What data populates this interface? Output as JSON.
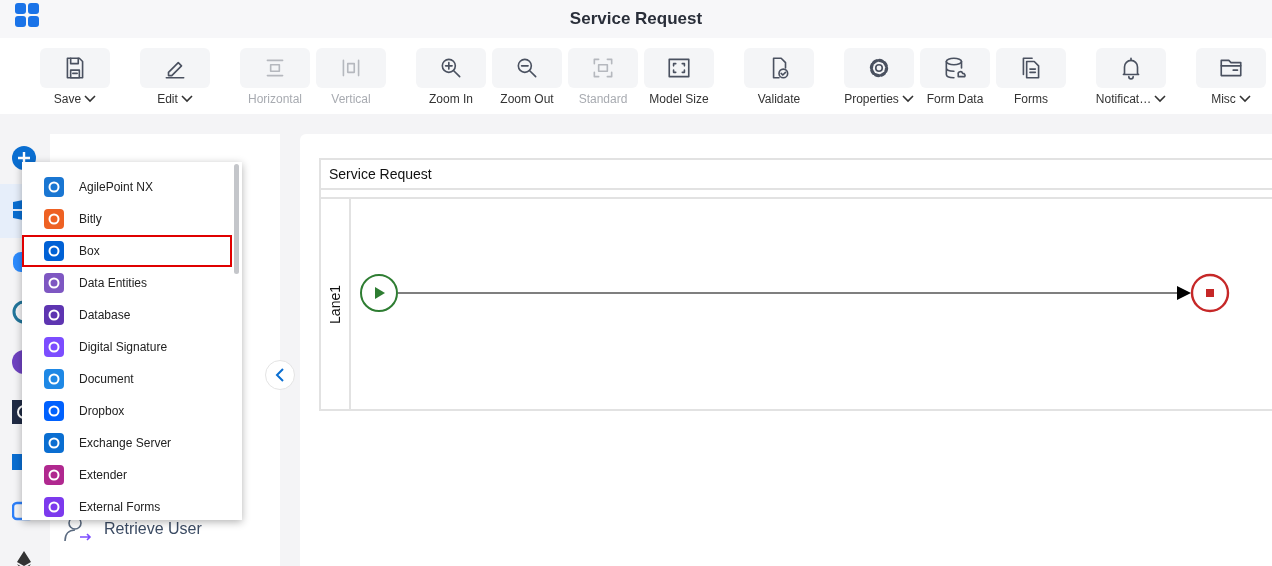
{
  "app": {
    "title": "Service Request"
  },
  "toolbar": [
    {
      "buttons": [
        {
          "label": "Save",
          "disabled": false,
          "menu": true
        }
      ]
    },
    {
      "buttons": [
        {
          "label": "Edit",
          "disabled": false,
          "menu": true
        }
      ]
    },
    {
      "buttons": [
        {
          "label": "Horizontal",
          "disabled": true,
          "menu": false
        },
        {
          "label": "Vertical",
          "disabled": true,
          "menu": false
        }
      ]
    },
    {
      "buttons": [
        {
          "label": "Zoom In",
          "disabled": false,
          "menu": false
        },
        {
          "label": "Zoom Out",
          "disabled": false,
          "menu": false
        },
        {
          "label": "Standard",
          "disabled": true,
          "menu": false
        },
        {
          "label": "Model Size",
          "disabled": false,
          "menu": false
        }
      ]
    },
    {
      "buttons": [
        {
          "label": "Validate",
          "disabled": false,
          "menu": false
        }
      ]
    },
    {
      "buttons": [
        {
          "label": "Properties",
          "disabled": false,
          "menu": true
        },
        {
          "label": "Form Data",
          "disabled": false,
          "menu": false
        },
        {
          "label": "Forms",
          "disabled": false,
          "menu": false
        }
      ]
    },
    {
      "buttons": [
        {
          "label": "Notificat…",
          "disabled": false,
          "menu": true
        }
      ]
    },
    {
      "buttons": [
        {
          "label": "Misc",
          "disabled": false,
          "menu": true
        }
      ]
    }
  ],
  "activity_menu": {
    "items": [
      {
        "label": "AgilePoint NX",
        "selected": false
      },
      {
        "label": "Bitly",
        "selected": false
      },
      {
        "label": "Box",
        "selected": true
      },
      {
        "label": "Data Entities",
        "selected": false
      },
      {
        "label": "Database",
        "selected": false
      },
      {
        "label": "Digital Signature",
        "selected": false
      },
      {
        "label": "Document",
        "selected": false
      },
      {
        "label": "Dropbox",
        "selected": false
      },
      {
        "label": "Exchange Server",
        "selected": false
      },
      {
        "label": "Extender",
        "selected": false
      },
      {
        "label": "External Forms",
        "selected": false
      }
    ]
  },
  "library": {
    "items": [
      {
        "label": "Retrieve User"
      }
    ]
  },
  "canvas": {
    "pool": {
      "title": "Service Request",
      "lanes": [
        {
          "label": "Lane1"
        }
      ]
    }
  }
}
